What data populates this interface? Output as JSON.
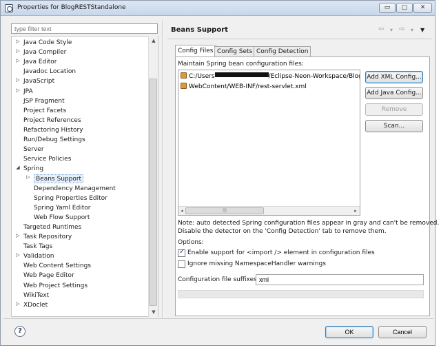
{
  "window": {
    "title": "Properties for BlogRESTStandalone",
    "min_label": "▭",
    "max_label": "▢",
    "close_label": "✕"
  },
  "filter": {
    "placeholder": "type filter text"
  },
  "tree": {
    "items": [
      {
        "label": "Java Code Style",
        "arrow": "▷"
      },
      {
        "label": "Java Compiler",
        "arrow": "▷"
      },
      {
        "label": "Java Editor",
        "arrow": "▷"
      },
      {
        "label": "Javadoc Location",
        "arrow": ""
      },
      {
        "label": "JavaScript",
        "arrow": "▷"
      },
      {
        "label": "JPA",
        "arrow": "▷"
      },
      {
        "label": "JSP Fragment",
        "arrow": ""
      },
      {
        "label": "Project Facets",
        "arrow": ""
      },
      {
        "label": "Project References",
        "arrow": ""
      },
      {
        "label": "Refactoring History",
        "arrow": ""
      },
      {
        "label": "Run/Debug Settings",
        "arrow": ""
      },
      {
        "label": "Server",
        "arrow": ""
      },
      {
        "label": "Service Policies",
        "arrow": ""
      },
      {
        "label": "Spring",
        "arrow": "◢"
      },
      {
        "label": "Beans Support",
        "arrow": "▷"
      },
      {
        "label": "Dependency Management",
        "arrow": ""
      },
      {
        "label": "Spring Properties Editor",
        "arrow": ""
      },
      {
        "label": "Spring Yaml Editor",
        "arrow": ""
      },
      {
        "label": "Web Flow Support",
        "arrow": ""
      },
      {
        "label": "Targeted Runtimes",
        "arrow": ""
      },
      {
        "label": "Task Repository",
        "arrow": "▷"
      },
      {
        "label": "Task Tags",
        "arrow": ""
      },
      {
        "label": "Validation",
        "arrow": "▷"
      },
      {
        "label": "Web Content Settings",
        "arrow": ""
      },
      {
        "label": "Web Page Editor",
        "arrow": ""
      },
      {
        "label": "Web Project Settings",
        "arrow": ""
      },
      {
        "label": "WikiText",
        "arrow": ""
      },
      {
        "label": "XDoclet",
        "arrow": "▷"
      }
    ],
    "scroll_up": "▲",
    "scroll_down": "▼"
  },
  "page": {
    "title": "Beans Support",
    "nav_back": "⇦",
    "nav_back_menu": "▾",
    "nav_forward": "⇨",
    "nav_forward_menu": "▾",
    "view_menu": "▼"
  },
  "tabs": [
    {
      "label": "Config Files",
      "active": true
    },
    {
      "label": "Config Sets",
      "active": false
    },
    {
      "label": "Config Detection",
      "active": false
    }
  ],
  "config_files": {
    "heading": "Maintain Spring bean configuration files:",
    "files": [
      {
        "prefix": "C:/Users",
        "suffix": "/Eclipse-Neon-Workspace/BlogR"
      },
      {
        "prefix": "WebContent/WEB-INF/rest-servlet.xml",
        "suffix": ""
      }
    ],
    "hscroll_left": "◂",
    "hscroll_grip": "|||",
    "hscroll_right": "▸",
    "buttons": {
      "add_xml": "Add XML Config...",
      "add_java": "Add Java Config...",
      "remove": "Remove",
      "scan": "Scan..."
    },
    "note_line1": "Note: auto detected Spring configuration files appear in gray and can't be removed.",
    "note_line2": "Disable the detector on the 'Config Detection' tab to remove them.",
    "options_label": "Options:",
    "enable_import": {
      "label": "Enable support for <import /> element in configuration files",
      "checked": true
    },
    "ignore_missing": {
      "label": "Ignore missing NamespaceHandler warnings",
      "checked": false
    },
    "suffixes_label": "Configuration file suffixes:",
    "suffixes_value": "xml"
  },
  "footer": {
    "help": "?",
    "ok": "OK",
    "cancel": "Cancel"
  },
  "colors": {
    "selection_bg": "#e5f0fb",
    "focus_border": "#3c7fb1",
    "file_icon": "#d89a3c"
  }
}
